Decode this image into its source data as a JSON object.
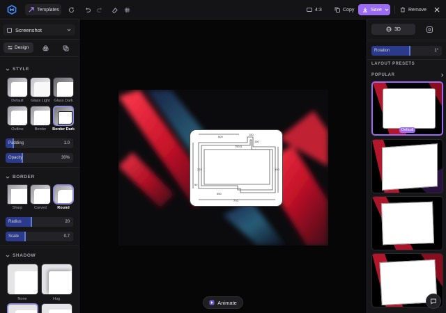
{
  "topbar": {
    "templates_label": "Templates",
    "ratio_label": "4:3",
    "copy_label": "Copy",
    "save_label": "Save",
    "remove_label": "Remove"
  },
  "left": {
    "panel_select": "Screenshot",
    "tabs": {
      "design": "Design"
    },
    "style_title": "STYLE",
    "style_options": [
      "Default",
      "Glass Light",
      "Glass Dark",
      "Outline",
      "Border",
      "Border Dark"
    ],
    "style_selected": "Border Dark",
    "padding": {
      "label": "Padding",
      "value": "1.0",
      "fraction": 0.12
    },
    "opacity": {
      "label": "Opacity",
      "value": "30%",
      "fraction": 0.3
    },
    "border_title": "BORDER",
    "border_options": [
      "Sharp",
      "Curved",
      "Round"
    ],
    "border_selected": "Round",
    "radius": {
      "label": "Radius",
      "value": "20",
      "fraction": 0.4
    },
    "scale": {
      "label": "Scale",
      "value": "0.7",
      "fraction": 0.3
    },
    "shadow_title": "SHADOW",
    "shadow_options": [
      "None",
      "Hug"
    ]
  },
  "right": {
    "mode_3d": "3D",
    "rotation": {
      "label": "Rotation",
      "value": "1°",
      "fraction": 0.55
    },
    "layout_title": "LAYOUT PRESETS",
    "popular_title": "POPULAR",
    "default_badge": "Default"
  },
  "drawing": {
    "dims": [
      "600",
      "150",
      "150",
      "750,5",
      "215",
      "400",
      "550",
      "770",
      "50"
    ]
  },
  "animate_label": "Animate",
  "colors": {
    "accent": "#9b6bf2",
    "slider": "#2b3a8a",
    "panel": "#161618"
  }
}
